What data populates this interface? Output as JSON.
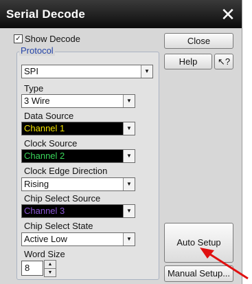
{
  "window": {
    "title": "Serial Decode",
    "close_glyph": "✕"
  },
  "show_decode": {
    "label": "Show Decode",
    "checked": true,
    "check_glyph": "✓"
  },
  "protocol": {
    "legend": "Protocol",
    "value": "SPI",
    "fields": {
      "type": {
        "label": "Type",
        "value": "3 Wire"
      },
      "data_source": {
        "label": "Data Source",
        "value": "Channel 1",
        "color": "#f2e200"
      },
      "clock_source": {
        "label": "Clock Source",
        "value": "Channel 2",
        "color": "#39d65a"
      },
      "clock_edge": {
        "label": "Clock Edge Direction",
        "value": "Rising"
      },
      "chip_select_source": {
        "label": "Chip Select Source",
        "value": "Channel 3",
        "color": "#8a55d6"
      },
      "chip_select_state": {
        "label": "Chip Select State",
        "value": "Active Low"
      },
      "word_size": {
        "label": "Word Size",
        "value": "8"
      }
    }
  },
  "buttons": {
    "close": "Close",
    "help": "Help",
    "whats_this": "?",
    "auto_setup": "Auto Setup",
    "manual_setup": "Manual Setup..."
  },
  "annotation": {
    "arrow_color": "#e01010",
    "points_to": "Auto Setup"
  },
  "icons": {
    "dropdown": "▼",
    "spin_up": "▲",
    "spin_down": "▼",
    "pointer": "↖"
  }
}
